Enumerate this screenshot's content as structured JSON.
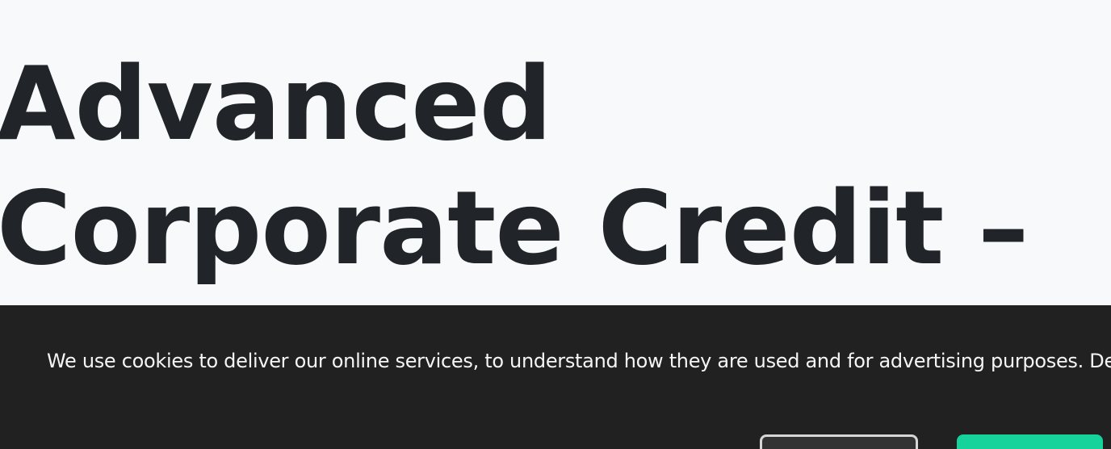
{
  "hero": {
    "title": "Advanced Corporate Credit – Warning"
  },
  "cookie_banner": {
    "message": "We use cookies to deliver our online services, to understand how they are used and for advertising purposes. Detai",
    "settings_button": "",
    "accept_button": ""
  },
  "colors": {
    "background": "#f8f9fa",
    "title": "#212529",
    "banner": "#212121",
    "banner_text": "#f5f5f5",
    "accent": "#16d39b"
  }
}
